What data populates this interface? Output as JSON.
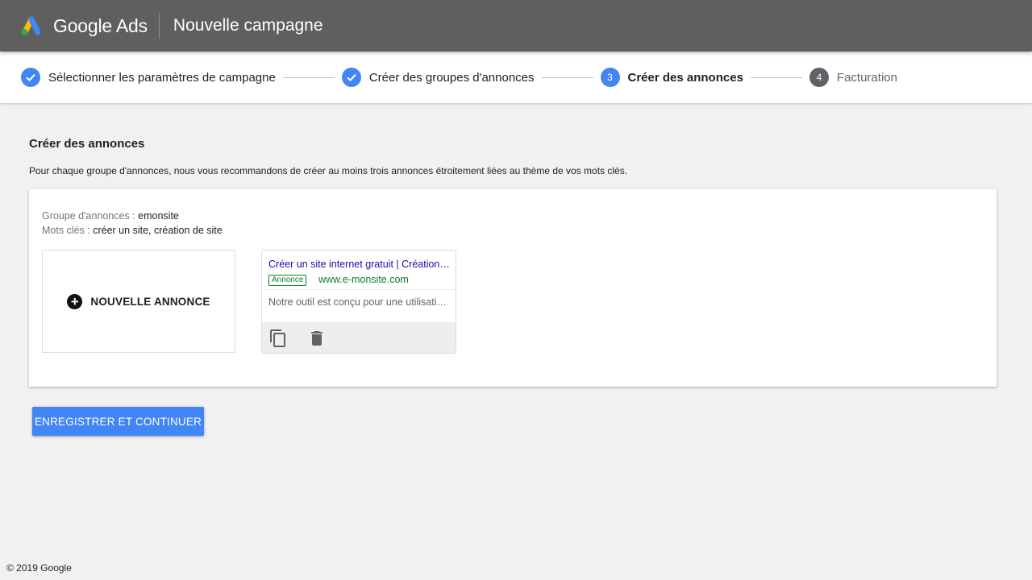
{
  "header": {
    "brand": "Google Ads",
    "page_title": "Nouvelle campagne",
    "logo_colors": {
      "blue": "#4285f4",
      "yellow": "#fbbc04",
      "green": "#34a853"
    }
  },
  "stepper": {
    "steps": [
      {
        "label": "Sélectionner les paramètres de campagne",
        "state": "done",
        "number": ""
      },
      {
        "label": "Créer des groupes d'annonces",
        "state": "done",
        "number": ""
      },
      {
        "label": "Créer des annonces",
        "state": "active",
        "number": "3"
      },
      {
        "label": "Facturation",
        "state": "pending",
        "number": "4"
      }
    ]
  },
  "main": {
    "title": "Créer des annonces",
    "description": "Pour chaque groupe d'annonces, nous vous recommandons de créer au moins trois annonces étroitement liées au thème de vos mots clés.",
    "ad_group": {
      "group_label": "Groupe d'annonces :",
      "group_value": "emonsite",
      "keywords_label": "Mots clés :",
      "keywords_value": "créer un site, création de site"
    },
    "new_ad_label": "NOUVELLE ANNONCE",
    "ad_preview": {
      "headline": "Créer un site internet gratuit | Création de site",
      "badge": "Annonce",
      "url": "www.e-monsite.com",
      "description": "Notre outil est conçu pour une utilisation simple",
      "actions": [
        {
          "icon": "copy-icon"
        },
        {
          "icon": "delete-icon"
        }
      ]
    },
    "save_label": "ENREGISTRER ET CONTINUER"
  },
  "footer": {
    "copyright": "© 2019 Google"
  },
  "colors": {
    "accent": "#4285f4",
    "topbar": "#5f5f5f",
    "ad_link": "#1a0dab",
    "ad_green": "#0d7c2a"
  }
}
